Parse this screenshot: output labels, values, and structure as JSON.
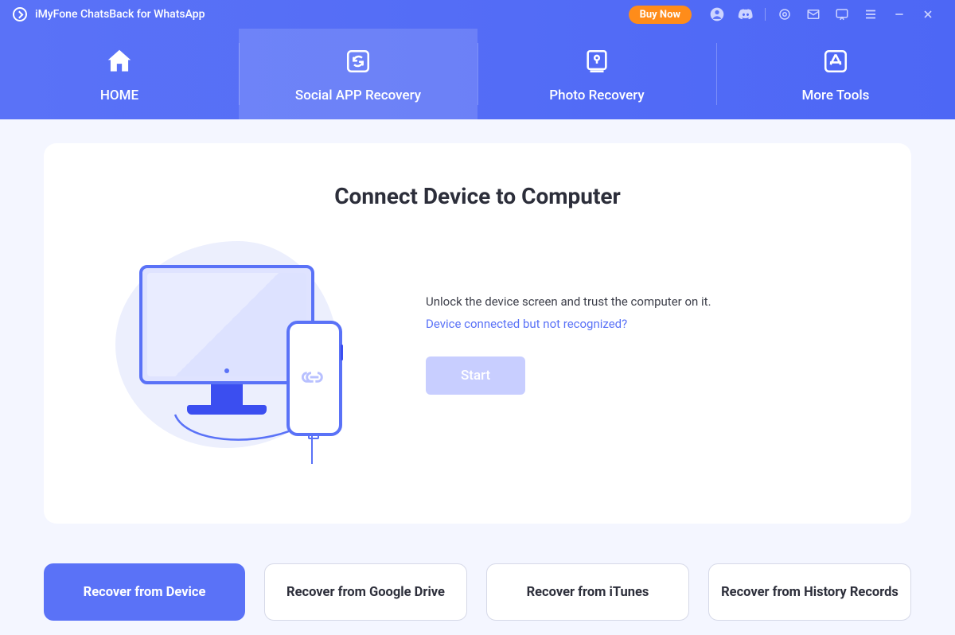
{
  "titlebar": {
    "title": "iMyFone ChatsBack for WhatsApp",
    "buy": "Buy Now"
  },
  "nav": {
    "tabs": [
      {
        "label": "HOME"
      },
      {
        "label": "Social APP Recovery"
      },
      {
        "label": "Photo Recovery"
      },
      {
        "label": "More Tools"
      }
    ],
    "activeIndex": 1
  },
  "main": {
    "title": "Connect Device to Computer",
    "instruction": "Unlock the device screen and trust the computer on it.",
    "troubleshoot_link": "Device connected but not recognized?",
    "start_label": "Start"
  },
  "options": [
    {
      "label": "Recover from Device",
      "primary": true
    },
    {
      "label": "Recover from Google Drive",
      "primary": false
    },
    {
      "label": "Recover from iTunes",
      "primary": false
    },
    {
      "label": "Recover from History Records",
      "primary": false
    }
  ],
  "colors": {
    "brand": "#5a72f7",
    "accent": "#ff8c1a",
    "bg": "#f4f6ff"
  }
}
